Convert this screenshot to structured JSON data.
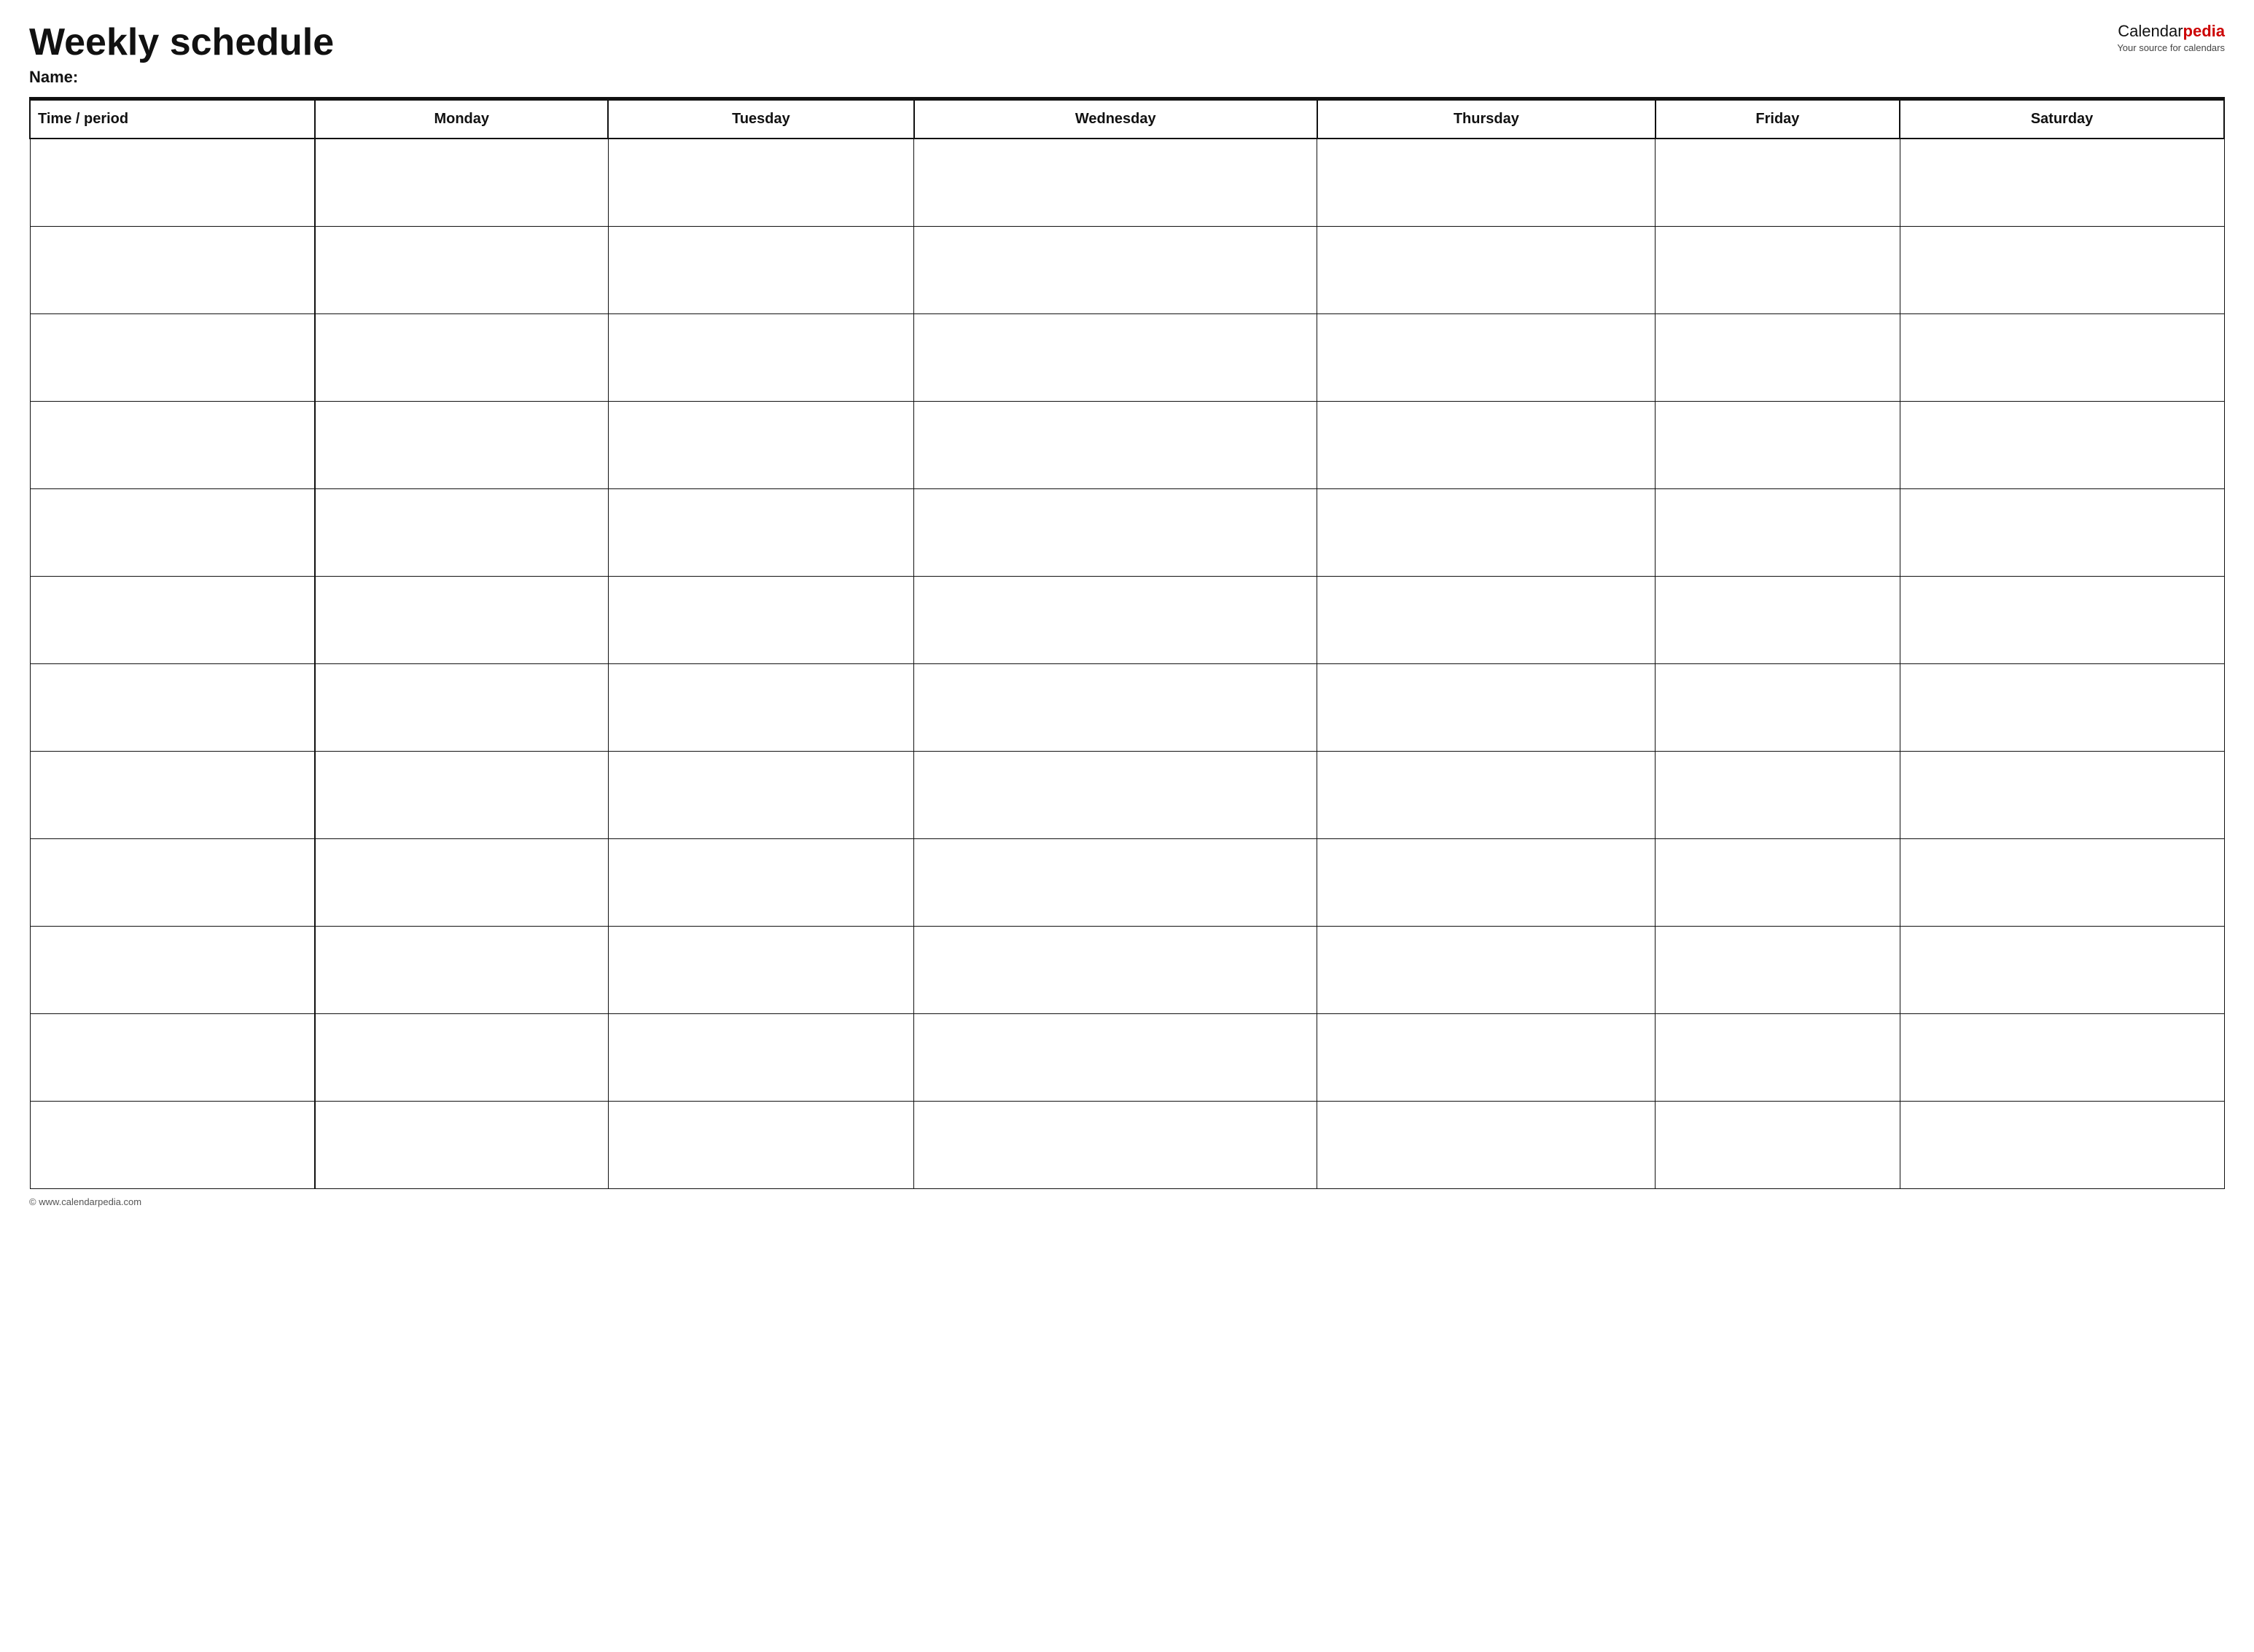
{
  "header": {
    "title": "Weekly schedule",
    "name_label": "Name:",
    "logo_calendar": "Calendar",
    "logo_pedia": "pedia",
    "logo_tagline": "Your source for calendars"
  },
  "table": {
    "columns": [
      "Time / period",
      "Monday",
      "Tuesday",
      "Wednesday",
      "Thursday",
      "Friday",
      "Saturday"
    ],
    "row_count": 12
  },
  "footer": {
    "text": "© www.calendarpedia.com"
  }
}
